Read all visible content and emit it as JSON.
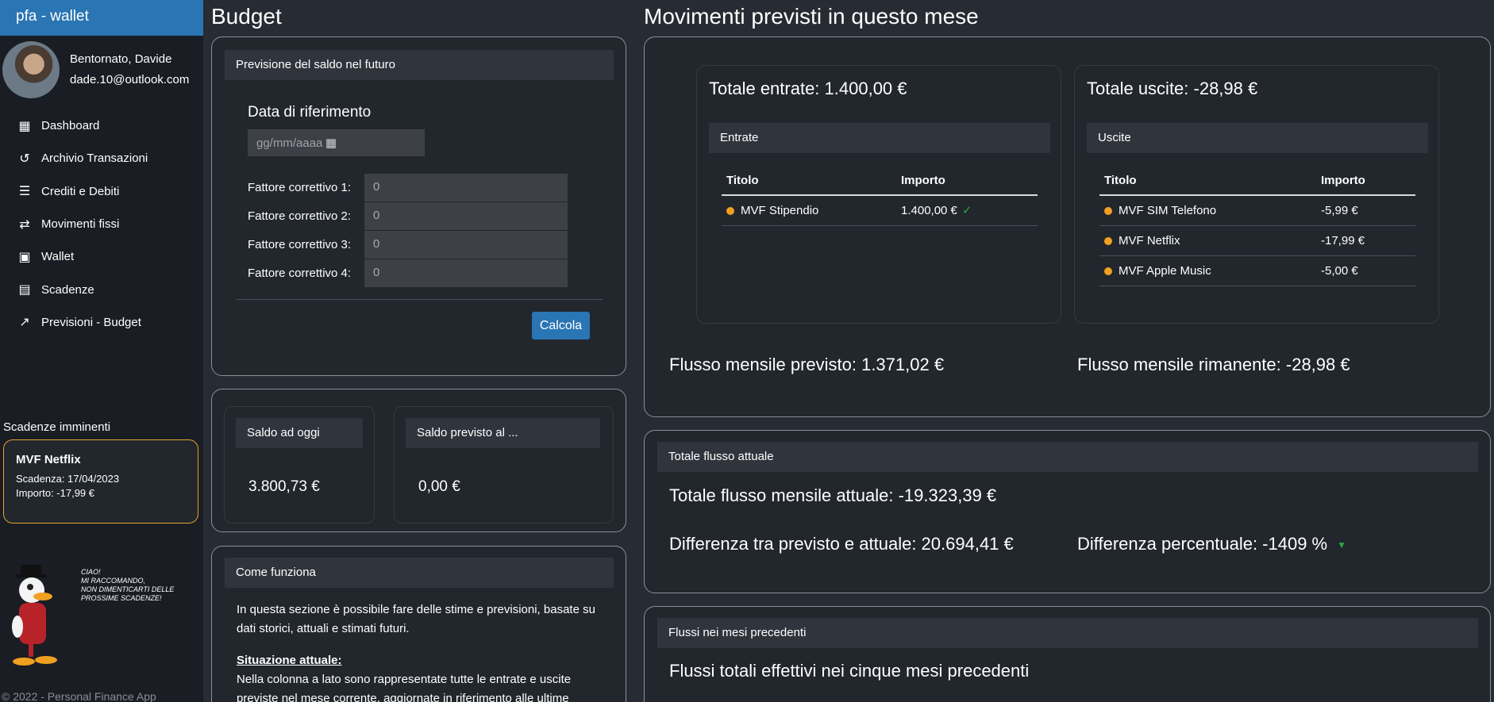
{
  "app": {
    "brand": "pfa - wallet",
    "footer": "© 2022 - Personal Finance App"
  },
  "user": {
    "greeting": "Bentornato, Davide",
    "email": "dade.10@outlook.com"
  },
  "nav": [
    {
      "label": "Dashboard",
      "icon": "dashboard-icon"
    },
    {
      "label": "Archivio Transazioni",
      "icon": "history-icon"
    },
    {
      "label": "Crediti e Debiti",
      "icon": "list-icon"
    },
    {
      "label": "Movimenti fissi",
      "icon": "swap-icon"
    },
    {
      "label": "Wallet",
      "icon": "wallet-icon"
    },
    {
      "label": "Scadenze",
      "icon": "calendar-icon"
    },
    {
      "label": "Previsioni - Budget",
      "icon": "trend-icon"
    }
  ],
  "scadenze": {
    "title": "Scadenze imminenti",
    "item": {
      "name": "MVF Netflix",
      "scadenza": "Scadenza: 17/04/2023",
      "importo": "Importo: -17,99 €"
    }
  },
  "mascot": {
    "bubble": "CIAO!\nMI RACCOMANDO,\nNON DIMENTICARTI DELLE\nPROSSIME SCADENZE!"
  },
  "budget": {
    "title": "Budget",
    "previsione": {
      "header": "Previsione del saldo nel futuro",
      "ref_label": "Data di riferimento",
      "date_placeholder": "gg/mm/aaaa",
      "fattori": [
        {
          "label": "Fattore correttivo 1:",
          "value": "0"
        },
        {
          "label": "Fattore correttivo 2:",
          "value": "0"
        },
        {
          "label": "Fattore correttivo 3:",
          "value": "0"
        },
        {
          "label": "Fattore correttivo 4:",
          "value": "0"
        }
      ],
      "button": "Calcola"
    },
    "saldo_oggi": {
      "header": "Saldo ad oggi",
      "value": "3.800,73 €"
    },
    "saldo_previsto": {
      "header": "Saldo previsto al ...",
      "value": "0,00 €"
    },
    "come_funziona": {
      "header": "Come funziona",
      "p1": "In questa sezione è possibile fare delle stime e previsioni, basate su dati storici, attuali e stimati futuri.",
      "sit_title": "Situazione attuale:",
      "sit_text": "Nella colonna a lato sono rappresentate tutte le entrate e uscite previste nel mese corrente, aggiornate in riferimento alle ultime"
    }
  },
  "movimenti": {
    "title": "Movimenti previsti in questo mese",
    "entrate": {
      "total": "Totale entrate: 1.400,00 €",
      "header": "Entrate",
      "columns": [
        "Titolo",
        "Importo"
      ],
      "rows": [
        {
          "titolo": "MVF Stipendio",
          "importo": "1.400,00 €"
        }
      ]
    },
    "uscite": {
      "total": "Totale uscite: -28,98 €",
      "header": "Uscite",
      "columns": [
        "Titolo",
        "Importo"
      ],
      "rows": [
        {
          "titolo": "MVF SIM Telefono",
          "importo": "-5,99 €"
        },
        {
          "titolo": "MVF Netflix",
          "importo": "-17,99 €"
        },
        {
          "titolo": "MVF Apple Music",
          "importo": "-5,00 €"
        }
      ]
    },
    "flusso_previsto": "Flusso mensile previsto: 1.371,02 €",
    "flusso_rimanente": "Flusso mensile rimanente: -28,98 €"
  },
  "flusso_attuale": {
    "header": "Totale flusso attuale",
    "totale": "Totale flusso mensile attuale: -19.323,39 €",
    "differenza": "Differenza tra previsto e attuale: 20.694,41 €",
    "percentuale": "Differenza percentuale: -1409 %"
  },
  "mesi_precedenti": {
    "header": "Flussi nei mesi precedenti",
    "title": "Flussi totali effettivi nei cinque mesi precedenti"
  },
  "colors": {
    "accent": "#2a75b3",
    "warning": "#f0a020",
    "success": "#28a745"
  }
}
